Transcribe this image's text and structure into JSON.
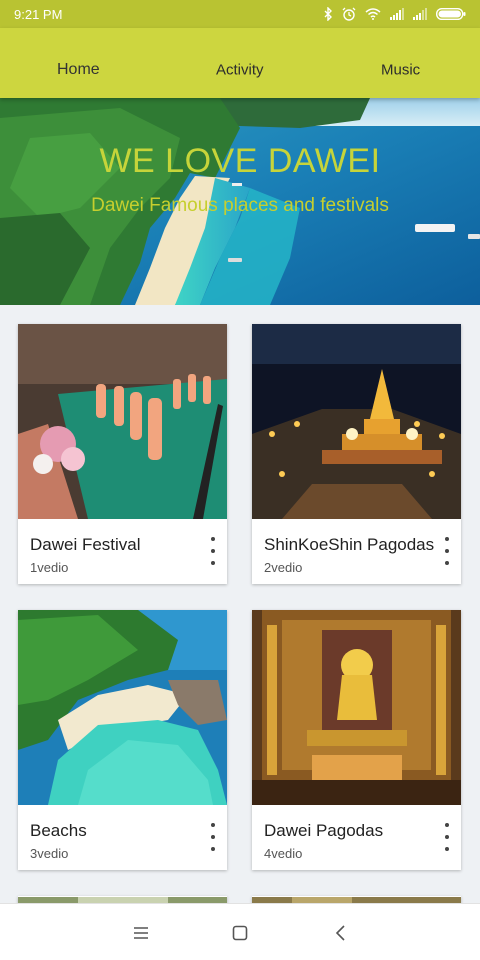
{
  "status": {
    "time": "9:21 PM"
  },
  "tabs": [
    {
      "label": "Home"
    },
    {
      "label": "Activity"
    },
    {
      "label": "Music"
    }
  ],
  "hero": {
    "title": "WE LOVE DAWEI",
    "subtitle": "Dawei Famous places and festivals"
  },
  "cards": [
    {
      "title": "Dawei Festival",
      "subtitle": "1vedio"
    },
    {
      "title": "ShinKoeShin Pagodas",
      "subtitle": "2vedio"
    },
    {
      "title": "Beachs",
      "subtitle": "3vedio"
    },
    {
      "title": "Dawei Pagodas",
      "subtitle": "4vedio"
    }
  ],
  "colors": {
    "status_bar": "#b9c332",
    "app_bar": "#cdd63f",
    "hero_text": "#c6d43a"
  }
}
